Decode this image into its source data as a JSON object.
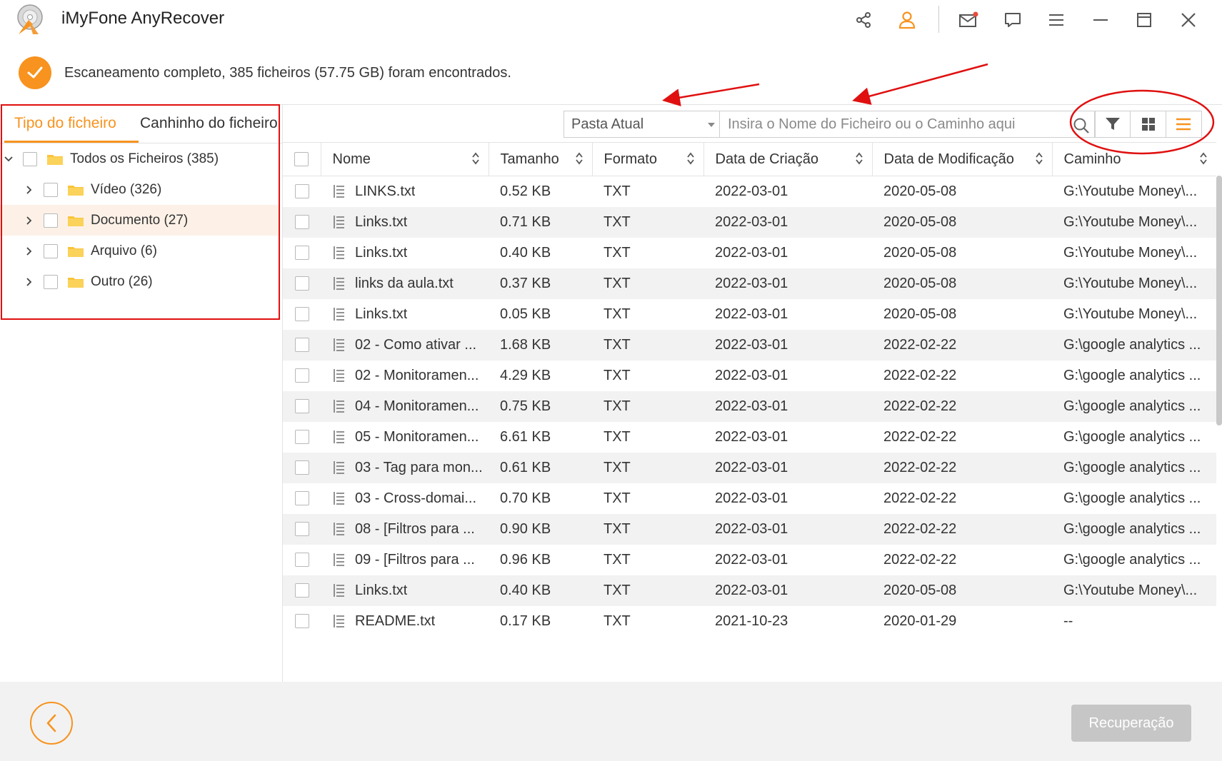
{
  "app": {
    "title": "iMyFone AnyRecover"
  },
  "status": {
    "message": "Escaneamento completo, 385 ficheiros (57.75 GB) foram encontrados."
  },
  "left_panel": {
    "tabs": [
      {
        "label": "Tipo do ficheiro",
        "active": true
      },
      {
        "label": "Canhinho do ficheiro",
        "active": false
      }
    ],
    "tree": [
      {
        "label": "Todos os Ficheiros (385)",
        "expanded": true,
        "level": 0
      },
      {
        "label": "Vídeo (326)",
        "expanded": false,
        "level": 1
      },
      {
        "label": "Documento (27)",
        "expanded": false,
        "level": 1,
        "selected": true
      },
      {
        "label": "Arquivo (6)",
        "expanded": false,
        "level": 1
      },
      {
        "label": "Outro (26)",
        "expanded": false,
        "level": 1
      }
    ]
  },
  "toolbar": {
    "location_value": "Pasta Atual",
    "search_placeholder": "Insira o Nome do Ficheiro ou o Caminho aqui"
  },
  "table": {
    "columns": [
      "Nome",
      "Tamanho",
      "Formato",
      "Data de Criação",
      "Data de Modificação",
      "Caminho"
    ],
    "rows": [
      {
        "name": "LINKS.txt",
        "size": "0.52 KB",
        "format": "TXT",
        "created": "2022-03-01",
        "modified": "2020-05-08",
        "path": "G:\\Youtube Money\\..."
      },
      {
        "name": "Links.txt",
        "size": "0.71 KB",
        "format": "TXT",
        "created": "2022-03-01",
        "modified": "2020-05-08",
        "path": "G:\\Youtube Money\\..."
      },
      {
        "name": "Links.txt",
        "size": "0.40 KB",
        "format": "TXT",
        "created": "2022-03-01",
        "modified": "2020-05-08",
        "path": "G:\\Youtube Money\\..."
      },
      {
        "name": "links da aula.txt",
        "size": "0.37 KB",
        "format": "TXT",
        "created": "2022-03-01",
        "modified": "2020-05-08",
        "path": "G:\\Youtube Money\\..."
      },
      {
        "name": "Links.txt",
        "size": "0.05 KB",
        "format": "TXT",
        "created": "2022-03-01",
        "modified": "2020-05-08",
        "path": "G:\\Youtube Money\\..."
      },
      {
        "name": "02 - Como ativar ...",
        "size": "1.68 KB",
        "format": "TXT",
        "created": "2022-03-01",
        "modified": "2022-02-22",
        "path": "G:\\google analytics ..."
      },
      {
        "name": "02 - Monitoramen...",
        "size": "4.29 KB",
        "format": "TXT",
        "created": "2022-03-01",
        "modified": "2022-02-22",
        "path": "G:\\google analytics ..."
      },
      {
        "name": "04 - Monitoramen...",
        "size": "0.75 KB",
        "format": "TXT",
        "created": "2022-03-01",
        "modified": "2022-02-22",
        "path": "G:\\google analytics ..."
      },
      {
        "name": "05 - Monitoramen...",
        "size": "6.61 KB",
        "format": "TXT",
        "created": "2022-03-01",
        "modified": "2022-02-22",
        "path": "G:\\google analytics ..."
      },
      {
        "name": "03 - Tag para mon...",
        "size": "0.61 KB",
        "format": "TXT",
        "created": "2022-03-01",
        "modified": "2022-02-22",
        "path": "G:\\google analytics ..."
      },
      {
        "name": "03 - Cross-domai...",
        "size": "0.70 KB",
        "format": "TXT",
        "created": "2022-03-01",
        "modified": "2022-02-22",
        "path": "G:\\google analytics ..."
      },
      {
        "name": "08 - [Filtros para ...",
        "size": "0.90 KB",
        "format": "TXT",
        "created": "2022-03-01",
        "modified": "2022-02-22",
        "path": "G:\\google analytics ..."
      },
      {
        "name": "09 - [Filtros para ...",
        "size": "0.96 KB",
        "format": "TXT",
        "created": "2022-03-01",
        "modified": "2022-02-22",
        "path": "G:\\google analytics ..."
      },
      {
        "name": "Links.txt",
        "size": "0.40 KB",
        "format": "TXT",
        "created": "2022-03-01",
        "modified": "2020-05-08",
        "path": "G:\\Youtube Money\\..."
      },
      {
        "name": "README.txt",
        "size": "0.17 KB",
        "format": "TXT",
        "created": "2021-10-23",
        "modified": "2020-01-29",
        "path": "--"
      }
    ]
  },
  "footer": {
    "recover_label": "Recuperação"
  },
  "icons": {
    "share": "share-icon",
    "user": "user-icon",
    "mail": "mail-icon",
    "feedback": "chat-icon",
    "menu": "menu-icon",
    "minimize": "minimize-icon",
    "maximize": "maximize-icon",
    "close": "close-icon",
    "filter": "filter-icon",
    "grid": "grid-view-icon",
    "list": "list-view-icon"
  },
  "colors": {
    "accent": "#f7931e",
    "annotation": "#e01010",
    "selected_row": "#fdf1e7",
    "disabled_button": "#c6c6c6"
  }
}
